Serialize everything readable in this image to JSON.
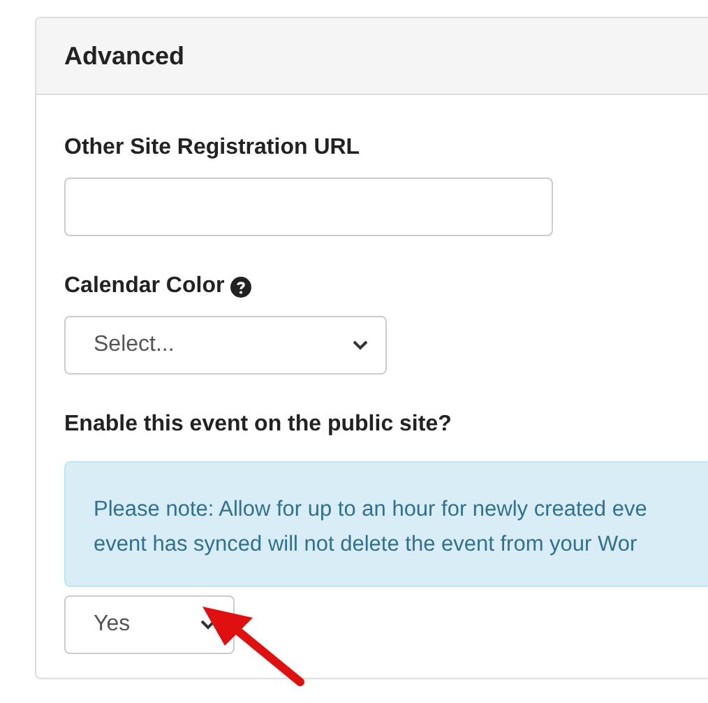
{
  "panel": {
    "title": "Advanced"
  },
  "fields": [
    {
      "kind": "text",
      "label": "Other Site Registration URL",
      "help": false
    },
    {
      "kind": "select",
      "label": "Calendar Color",
      "help": true,
      "value": "Select..."
    },
    {
      "kind": "notice_select",
      "label": "Enable this event on the public site?",
      "help": false,
      "notice": [
        "Please note: Allow for up to an hour for newly created eve",
        "event has synced will not delete the event from your Wor"
      ],
      "value": "Yes"
    }
  ]
}
